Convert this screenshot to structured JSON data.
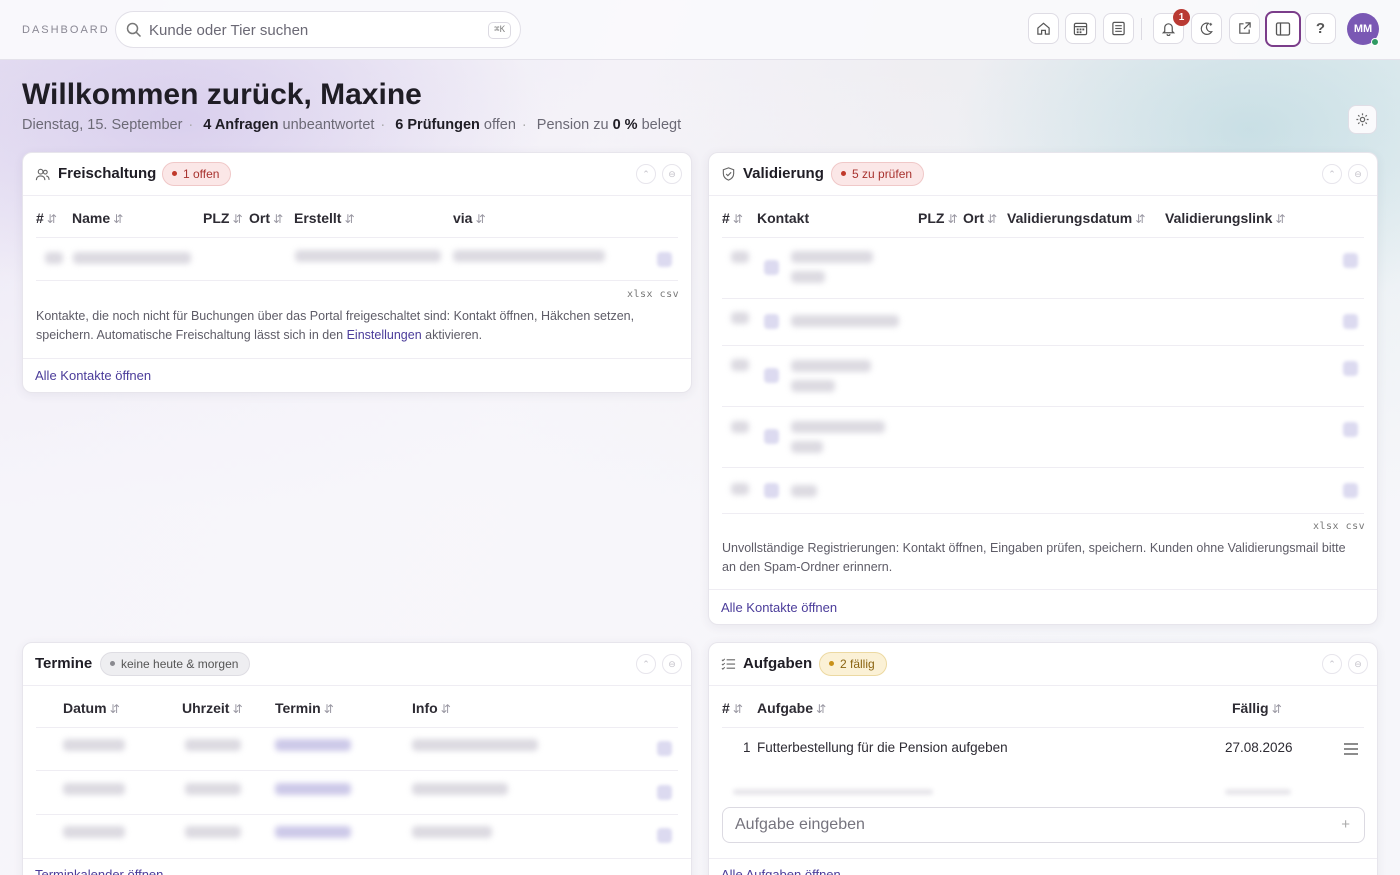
{
  "topbar": {
    "brand": "DASHBOARD",
    "search_placeholder": "Kunde oder Tier suchen",
    "shortcut": "⌘K",
    "notification_count": "1",
    "help_label": "?",
    "avatar_initials": "MM"
  },
  "header": {
    "greeting": "Willkommen zurück, Maxine",
    "date": "Dienstag, 15. September",
    "requests_count": "4 Anfragen",
    "requests_suffix": "unbeantwortet",
    "checks_count": "6 Prüfungen",
    "checks_suffix": "offen",
    "pension_prefix": "Pension zu",
    "pension_value": "0 %",
    "pension_suffix": "belegt"
  },
  "freischaltung": {
    "title": "Freischaltung",
    "badge": "1 offen",
    "columns": [
      "#",
      "Name",
      "PLZ",
      "Ort",
      "Erstellt",
      "via"
    ],
    "export_xlsx": "xlsx",
    "export_csv": "csv",
    "note_text": "Kontakte, die noch nicht für Buchungen über das Portal freigeschaltet sind: Kontakt öffnen, Häkchen setzen, speichern. Automatische Freischaltung lässt sich in den",
    "note_link": "Einstellungen",
    "note_end": "aktivieren.",
    "footer_link": "Alle Kontakte öffnen"
  },
  "validierung": {
    "title": "Validierung",
    "badge": "5 zu prüfen",
    "columns": [
      "#",
      "Kontakt",
      "PLZ",
      "Ort",
      "Validierungsdatum",
      "Validierungslink"
    ],
    "export_xlsx": "xlsx",
    "export_csv": "csv",
    "note_text": "Unvollständige Registrierungen: Kontakt öffnen, Eingaben prüfen, speichern. Kunden ohne Validierungsmail bitte an den Spam-Ordner erinnern.",
    "footer_link": "Alle Kontakte öffnen"
  },
  "termine": {
    "title": "Termine",
    "badge": "keine heute & morgen",
    "columns": [
      "Datum",
      "Uhrzeit",
      "Termin",
      "Info"
    ],
    "footer_link": "Terminkalender öffnen"
  },
  "aufgaben": {
    "title": "Aufgaben",
    "badge": "2 fällig",
    "columns": [
      "#",
      "Aufgabe",
      "Fällig"
    ],
    "tasks": [
      {
        "num": "1",
        "text": "Futterbestellung für die Pension aufgeben",
        "due": "27.08.2026"
      }
    ],
    "input_placeholder": "Aufgabe eingeben",
    "footer_link": "Alle Aufgaben öffnen"
  },
  "colors": {
    "accent": "#4b3c9a",
    "avatar": "#7a58b4",
    "danger": "#b93a33",
    "active_border": "#7b3d8a"
  }
}
